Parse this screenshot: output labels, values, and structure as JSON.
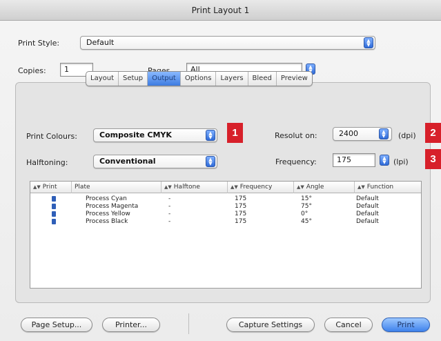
{
  "window": {
    "title": "Print Layout 1"
  },
  "print_style": {
    "label": "Print Style:",
    "value": "Default"
  },
  "copies": {
    "label": "Copies:",
    "value": "1"
  },
  "pages": {
    "label": "Pages",
    "value": "All"
  },
  "tabs": [
    {
      "label": "Layout",
      "active": false
    },
    {
      "label": "Setup",
      "active": false
    },
    {
      "label": "Output",
      "active": true
    },
    {
      "label": "Options",
      "active": false
    },
    {
      "label": "Layers",
      "active": false
    },
    {
      "label": "Bleed",
      "active": false
    },
    {
      "label": "Preview",
      "active": false
    }
  ],
  "output": {
    "print_colours_label": "Print Colours:",
    "print_colours_value": "Composite CMYK",
    "halftoning_label": "Halftoning:",
    "halftoning_value": "Conventional",
    "resolution_label": "Resolut on:",
    "resolution_value": "2400",
    "resolution_unit": "(dpi)",
    "frequency_label": "Frequency:",
    "frequency_value": "175",
    "frequency_unit": "(lpi)"
  },
  "badges": [
    "1",
    "2",
    "3"
  ],
  "table": {
    "headers": [
      "Print",
      "Plate",
      "Halftone",
      "Frequency",
      "Angle",
      "Function"
    ],
    "rows": [
      {
        "plate": "Process Cyan",
        "halftone": "-",
        "frequency": "175",
        "angle": "15°",
        "function": "Default"
      },
      {
        "plate": "Process Magenta",
        "halftone": "-",
        "frequency": "175",
        "angle": "75°",
        "function": "Default"
      },
      {
        "plate": "Process Yellow",
        "halftone": "-",
        "frequency": "175",
        "angle": "0°",
        "function": "Default"
      },
      {
        "plate": "Process Black",
        "halftone": "-",
        "frequency": "175",
        "angle": "45°",
        "function": "Default"
      }
    ]
  },
  "buttons": {
    "page_setup": "Page Setup...",
    "printer": "Printer...",
    "capture_settings": "Capture Settings",
    "cancel": "Cancel",
    "print": "Print"
  },
  "colors": {
    "accent": "#3f82ec",
    "badge": "#d7202a"
  }
}
